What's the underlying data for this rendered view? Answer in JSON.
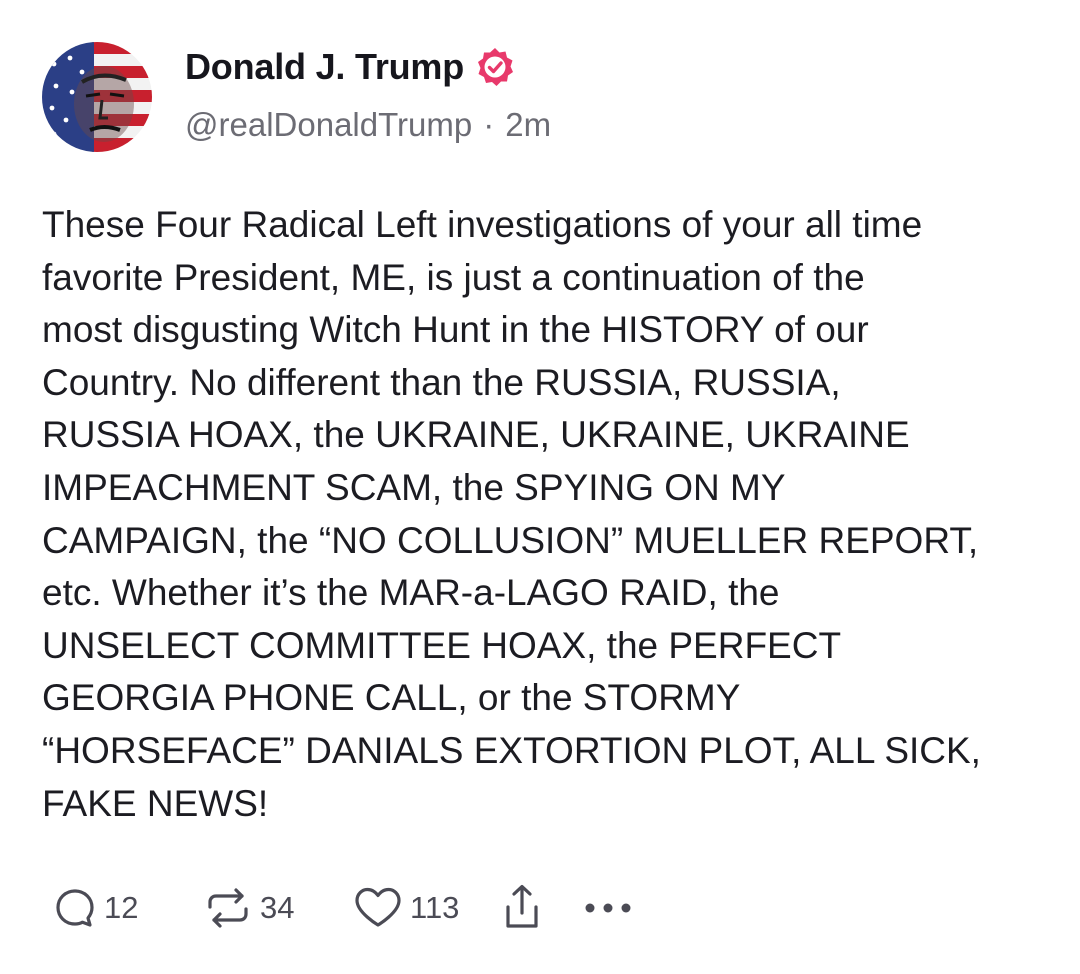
{
  "post": {
    "author": {
      "display_name": "Donald J. Trump",
      "verified_icon": "verified-badge-icon",
      "handle": "@realDonaldTrump",
      "separator": "·",
      "time_ago": "2m"
    },
    "body_lines": [
      "These Four Radical Left investigations of your all time",
      "favorite President, ME, is just a continuation of the",
      "most disgusting Witch Hunt in the HISTORY of our",
      "Country. No different than the RUSSIA, RUSSIA,",
      "RUSSIA HOAX, the UKRAINE, UKRAINE, UKRAINE",
      "IMPEACHMENT SCAM, the SPYING ON MY",
      "CAMPAIGN, the “NO COLLUSION” MUELLER REPORT,",
      "etc. Whether it’s the MAR-a-LAGO RAID, the",
      "UNSELECT COMMITTEE HOAX, the PERFECT",
      "GEORGIA PHONE CALL, or the STORMY",
      "“HORSEFACE” DANIALS EXTORTION PLOT, ALL SICK,",
      "FAKE NEWS!"
    ],
    "actions": {
      "reply_count": "12",
      "retruth_count": "34",
      "like_count": "113",
      "icons": [
        "reply-icon",
        "retruth-icon",
        "heart-icon",
        "share-icon",
        "more-icon"
      ]
    }
  },
  "colors": {
    "text": "#1c1c22",
    "muted": "#6c6c74",
    "badge": "#e8396b"
  }
}
